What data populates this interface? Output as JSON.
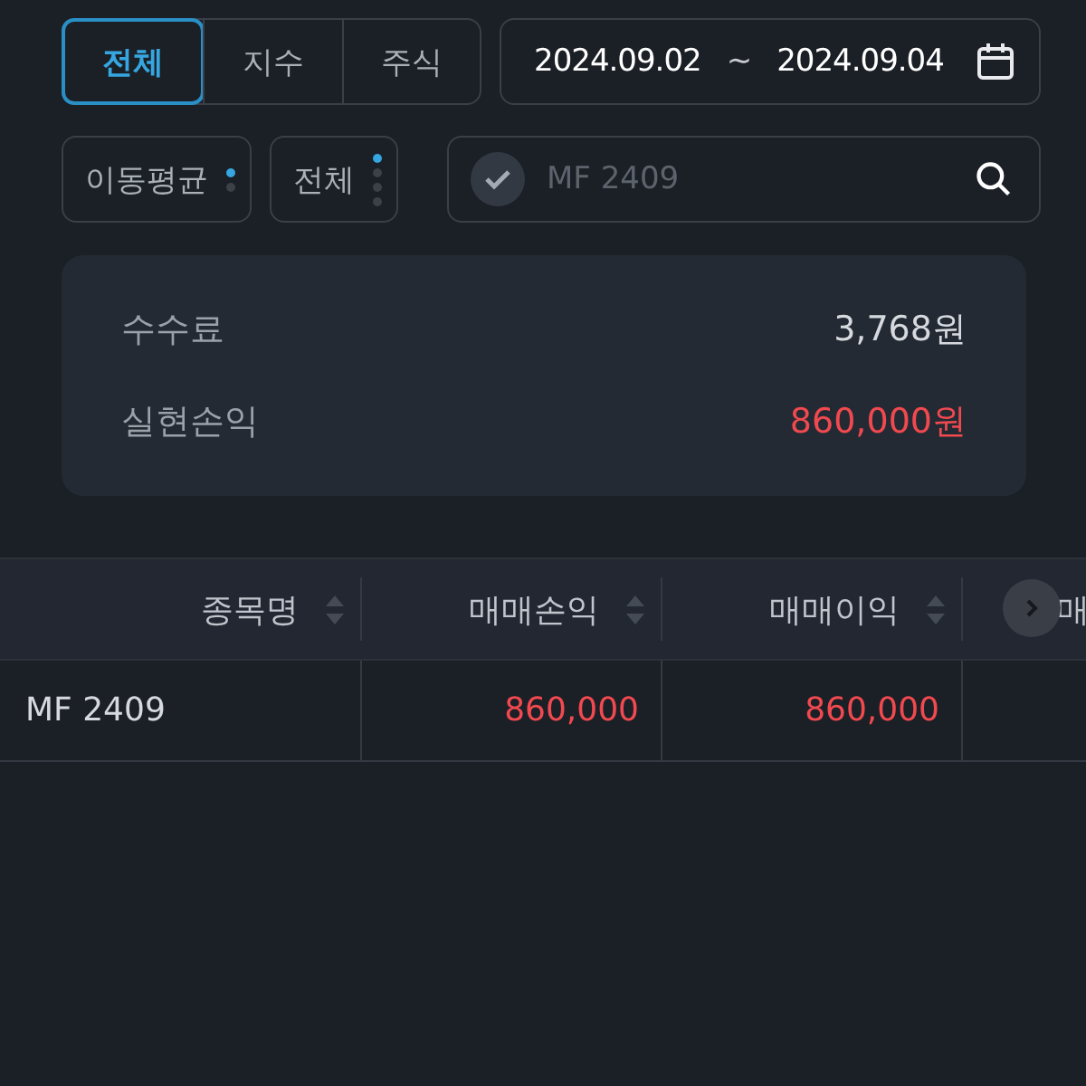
{
  "tabs": [
    {
      "label": "전체",
      "selected": true
    },
    {
      "label": "지수",
      "selected": false
    },
    {
      "label": "주식",
      "selected": false
    }
  ],
  "date_range": {
    "start": "2024.09.02",
    "separator": "~",
    "end": "2024.09.04"
  },
  "selects": [
    {
      "label": "이동평균",
      "dots": [
        {
          "selected": true
        },
        {
          "selected": false
        }
      ]
    },
    {
      "label": "전체",
      "dots": [
        {
          "selected": true
        },
        {
          "selected": false
        },
        {
          "selected": false
        },
        {
          "selected": false
        }
      ]
    }
  ],
  "search": {
    "placeholder": "MF 2409"
  },
  "summary": [
    {
      "label": "수수료",
      "value": "3,768원",
      "kind": "neutral"
    },
    {
      "label": "실현손익",
      "value": "860,000원",
      "kind": "profit"
    }
  ],
  "table": {
    "columns": [
      {
        "label": "종목명",
        "sortable": true
      },
      {
        "label": "매매손익",
        "sortable": true
      },
      {
        "label": "매매이익",
        "sortable": true
      },
      {
        "label": "매",
        "sortable": false
      }
    ],
    "rows": [
      {
        "cells": [
          {
            "text": "MF 2409",
            "kind": "name"
          },
          {
            "text": "860,000",
            "kind": "profit"
          },
          {
            "text": "860,000",
            "kind": "profit"
          }
        ]
      }
    ]
  }
}
